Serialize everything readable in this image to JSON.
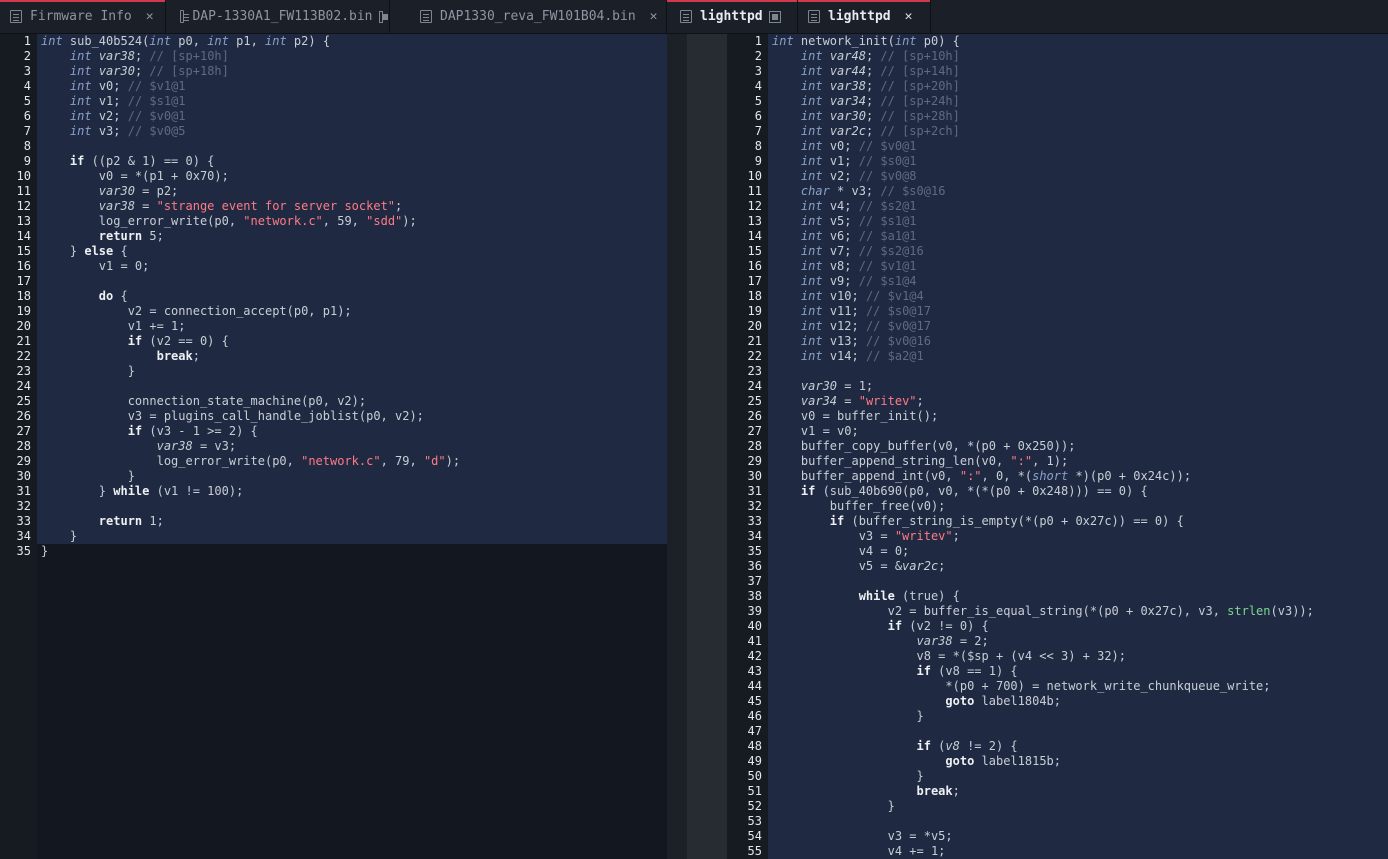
{
  "tabs": [
    {
      "label": "Firmware Info",
      "active": false,
      "close": "✕"
    },
    {
      "label": "DAP-1330A1_FW113B02.bin",
      "active": false
    },
    {
      "label": "DAP1330_reva_FW101B04.bin",
      "active": false,
      "close": "✕"
    },
    {
      "label": "lighttpd",
      "active": true
    },
    {
      "label": "lighttpd",
      "active": true,
      "close": "✕"
    }
  ],
  "colors": {
    "accent": "#d2394a",
    "code_bg": "#1f2a42",
    "editor_bg": "#131720"
  },
  "left_code": [
    [
      [
        "t",
        "int"
      ],
      [
        "p",
        " sub_40b524("
      ],
      [
        "t",
        "int"
      ],
      [
        "p",
        " p0, "
      ],
      [
        "t",
        "int"
      ],
      [
        "p",
        " p1, "
      ],
      [
        "t",
        "int"
      ],
      [
        "p",
        " p2) {"
      ]
    ],
    [
      [
        "p",
        "    "
      ],
      [
        "t",
        "int"
      ],
      [
        "p",
        " "
      ],
      [
        "v",
        "var38"
      ],
      [
        "p",
        "; "
      ],
      [
        "c",
        "// [sp+10h]"
      ]
    ],
    [
      [
        "p",
        "    "
      ],
      [
        "t",
        "int"
      ],
      [
        "p",
        " "
      ],
      [
        "v",
        "var30"
      ],
      [
        "p",
        "; "
      ],
      [
        "c",
        "// [sp+18h]"
      ]
    ],
    [
      [
        "p",
        "    "
      ],
      [
        "t",
        "int"
      ],
      [
        "p",
        " v0; "
      ],
      [
        "c",
        "// $v1@1"
      ]
    ],
    [
      [
        "p",
        "    "
      ],
      [
        "t",
        "int"
      ],
      [
        "p",
        " v1; "
      ],
      [
        "c",
        "// $s1@1"
      ]
    ],
    [
      [
        "p",
        "    "
      ],
      [
        "t",
        "int"
      ],
      [
        "p",
        " v2; "
      ],
      [
        "c",
        "// $v0@1"
      ]
    ],
    [
      [
        "p",
        "    "
      ],
      [
        "t",
        "int"
      ],
      [
        "p",
        " v3; "
      ],
      [
        "c",
        "// $v0@5"
      ]
    ],
    [],
    [
      [
        "p",
        "    "
      ],
      [
        "k",
        "if"
      ],
      [
        "p",
        " ((p2 & 1) == 0) {"
      ]
    ],
    [
      [
        "p",
        "        v0 = *(p1 + 0x70);"
      ]
    ],
    [
      [
        "p",
        "        "
      ],
      [
        "v",
        "var30"
      ],
      [
        "p",
        " = p2;"
      ]
    ],
    [
      [
        "p",
        "        "
      ],
      [
        "v",
        "var38"
      ],
      [
        "p",
        " = "
      ],
      [
        "s",
        "\"strange event for server socket\""
      ],
      [
        "p",
        ";"
      ]
    ],
    [
      [
        "p",
        "        log_error_write(p0, "
      ],
      [
        "s",
        "\"network.c\""
      ],
      [
        "p",
        ", 59, "
      ],
      [
        "s",
        "\"sdd\""
      ],
      [
        "p",
        ");"
      ]
    ],
    [
      [
        "p",
        "        "
      ],
      [
        "k",
        "return"
      ],
      [
        "p",
        " 5;"
      ]
    ],
    [
      [
        "p",
        "    } "
      ],
      [
        "k",
        "else"
      ],
      [
        "p",
        " {"
      ]
    ],
    [
      [
        "p",
        "        v1 = 0;"
      ]
    ],
    [],
    [
      [
        "p",
        "        "
      ],
      [
        "k",
        "do"
      ],
      [
        "p",
        " {"
      ]
    ],
    [
      [
        "p",
        "            v2 = connection_accept(p0, p1);"
      ]
    ],
    [
      [
        "p",
        "            v1 += 1;"
      ]
    ],
    [
      [
        "p",
        "            "
      ],
      [
        "k",
        "if"
      ],
      [
        "p",
        " (v2 == 0) {"
      ]
    ],
    [
      [
        "p",
        "                "
      ],
      [
        "k",
        "break"
      ],
      [
        "p",
        ";"
      ]
    ],
    [
      [
        "p",
        "            }"
      ]
    ],
    [],
    [
      [
        "p",
        "            connection_state_machine(p0, v2);"
      ]
    ],
    [
      [
        "p",
        "            v3 = plugins_call_handle_joblist(p0, v2);"
      ]
    ],
    [
      [
        "p",
        "            "
      ],
      [
        "k",
        "if"
      ],
      [
        "p",
        " (v3 - 1 >= 2) {"
      ]
    ],
    [
      [
        "p",
        "                "
      ],
      [
        "v",
        "var38"
      ],
      [
        "p",
        " = v3;"
      ]
    ],
    [
      [
        "p",
        "                log_error_write(p0, "
      ],
      [
        "s",
        "\"network.c\""
      ],
      [
        "p",
        ", 79, "
      ],
      [
        "s",
        "\"d\""
      ],
      [
        "p",
        ");"
      ]
    ],
    [
      [
        "p",
        "            }"
      ]
    ],
    [
      [
        "p",
        "        } "
      ],
      [
        "k",
        "while"
      ],
      [
        "p",
        " (v1 != 100);"
      ]
    ],
    [],
    [
      [
        "p",
        "        "
      ],
      [
        "k",
        "return"
      ],
      [
        "p",
        " 1;"
      ]
    ],
    [
      [
        "p",
        "    }"
      ]
    ],
    [
      [
        "p",
        "}"
      ]
    ]
  ],
  "right_code": [
    [
      [
        "t",
        "int"
      ],
      [
        "p",
        " network_init("
      ],
      [
        "t",
        "int"
      ],
      [
        "p",
        " p0) {"
      ]
    ],
    [
      [
        "p",
        "    "
      ],
      [
        "t",
        "int"
      ],
      [
        "p",
        " "
      ],
      [
        "v",
        "var48"
      ],
      [
        "p",
        "; "
      ],
      [
        "c",
        "// [sp+10h]"
      ]
    ],
    [
      [
        "p",
        "    "
      ],
      [
        "t",
        "int"
      ],
      [
        "p",
        " "
      ],
      [
        "v",
        "var44"
      ],
      [
        "p",
        "; "
      ],
      [
        "c",
        "// [sp+14h]"
      ]
    ],
    [
      [
        "p",
        "    "
      ],
      [
        "t",
        "int"
      ],
      [
        "p",
        " "
      ],
      [
        "v",
        "var38"
      ],
      [
        "p",
        "; "
      ],
      [
        "c",
        "// [sp+20h]"
      ]
    ],
    [
      [
        "p",
        "    "
      ],
      [
        "t",
        "int"
      ],
      [
        "p",
        " "
      ],
      [
        "v",
        "var34"
      ],
      [
        "p",
        "; "
      ],
      [
        "c",
        "// [sp+24h]"
      ]
    ],
    [
      [
        "p",
        "    "
      ],
      [
        "t",
        "int"
      ],
      [
        "p",
        " "
      ],
      [
        "v",
        "var30"
      ],
      [
        "p",
        "; "
      ],
      [
        "c",
        "// [sp+28h]"
      ]
    ],
    [
      [
        "p",
        "    "
      ],
      [
        "t",
        "int"
      ],
      [
        "p",
        " "
      ],
      [
        "v",
        "var2c"
      ],
      [
        "p",
        "; "
      ],
      [
        "c",
        "// [sp+2ch]"
      ]
    ],
    [
      [
        "p",
        "    "
      ],
      [
        "t",
        "int"
      ],
      [
        "p",
        " v0; "
      ],
      [
        "c",
        "// $v0@1"
      ]
    ],
    [
      [
        "p",
        "    "
      ],
      [
        "t",
        "int"
      ],
      [
        "p",
        " v1; "
      ],
      [
        "c",
        "// $s0@1"
      ]
    ],
    [
      [
        "p",
        "    "
      ],
      [
        "t",
        "int"
      ],
      [
        "p",
        " v2; "
      ],
      [
        "c",
        "// $v0@8"
      ]
    ],
    [
      [
        "p",
        "    "
      ],
      [
        "t",
        "char"
      ],
      [
        "p",
        " * v3; "
      ],
      [
        "c",
        "// $s0@16"
      ]
    ],
    [
      [
        "p",
        "    "
      ],
      [
        "t",
        "int"
      ],
      [
        "p",
        " v4; "
      ],
      [
        "c",
        "// $s2@1"
      ]
    ],
    [
      [
        "p",
        "    "
      ],
      [
        "t",
        "int"
      ],
      [
        "p",
        " v5; "
      ],
      [
        "c",
        "// $s1@1"
      ]
    ],
    [
      [
        "p",
        "    "
      ],
      [
        "t",
        "int"
      ],
      [
        "p",
        " v6; "
      ],
      [
        "c",
        "// $a1@1"
      ]
    ],
    [
      [
        "p",
        "    "
      ],
      [
        "t",
        "int"
      ],
      [
        "p",
        " v7; "
      ],
      [
        "c",
        "// $s2@16"
      ]
    ],
    [
      [
        "p",
        "    "
      ],
      [
        "t",
        "int"
      ],
      [
        "p",
        " v8; "
      ],
      [
        "c",
        "// $v1@1"
      ]
    ],
    [
      [
        "p",
        "    "
      ],
      [
        "t",
        "int"
      ],
      [
        "p",
        " v9; "
      ],
      [
        "c",
        "// $s1@4"
      ]
    ],
    [
      [
        "p",
        "    "
      ],
      [
        "t",
        "int"
      ],
      [
        "p",
        " v10; "
      ],
      [
        "c",
        "// $v1@4"
      ]
    ],
    [
      [
        "p",
        "    "
      ],
      [
        "t",
        "int"
      ],
      [
        "p",
        " v11; "
      ],
      [
        "c",
        "// $s0@17"
      ]
    ],
    [
      [
        "p",
        "    "
      ],
      [
        "t",
        "int"
      ],
      [
        "p",
        " v12; "
      ],
      [
        "c",
        "// $v0@17"
      ]
    ],
    [
      [
        "p",
        "    "
      ],
      [
        "t",
        "int"
      ],
      [
        "p",
        " v13; "
      ],
      [
        "c",
        "// $v0@16"
      ]
    ],
    [
      [
        "p",
        "    "
      ],
      [
        "t",
        "int"
      ],
      [
        "p",
        " v14; "
      ],
      [
        "c",
        "// $a2@1"
      ]
    ],
    [],
    [
      [
        "p",
        "    "
      ],
      [
        "v",
        "var30"
      ],
      [
        "p",
        " = 1;"
      ]
    ],
    [
      [
        "p",
        "    "
      ],
      [
        "v",
        "var34"
      ],
      [
        "p",
        " = "
      ],
      [
        "s",
        "\"writev\""
      ],
      [
        "p",
        ";"
      ]
    ],
    [
      [
        "p",
        "    v0 = buffer_init();"
      ]
    ],
    [
      [
        "p",
        "    v1 = v0;"
      ]
    ],
    [
      [
        "p",
        "    buffer_copy_buffer(v0, *(p0 + 0x250));"
      ]
    ],
    [
      [
        "p",
        "    buffer_append_string_len(v0, "
      ],
      [
        "s",
        "\":\""
      ],
      [
        "p",
        ", 1);"
      ]
    ],
    [
      [
        "p",
        "    buffer_append_int(v0, "
      ],
      [
        "s",
        "\":\""
      ],
      [
        "p",
        ", 0, *("
      ],
      [
        "t",
        "short"
      ],
      [
        "p",
        " *)(p0 + 0x24c));"
      ]
    ],
    [
      [
        "p",
        "    "
      ],
      [
        "k",
        "if"
      ],
      [
        "p",
        " (sub_40b690(p0, v0, *(*(p0 + 0x248))) == 0) {"
      ]
    ],
    [
      [
        "p",
        "        buffer_free(v0);"
      ]
    ],
    [
      [
        "p",
        "        "
      ],
      [
        "k",
        "if"
      ],
      [
        "p",
        " (buffer_string_is_empty(*(p0 + 0x27c)) == 0) {"
      ]
    ],
    [
      [
        "p",
        "            v3 = "
      ],
      [
        "s",
        "\"writev\""
      ],
      [
        "p",
        ";"
      ]
    ],
    [
      [
        "p",
        "            v4 = 0;"
      ]
    ],
    [
      [
        "p",
        "            v5 = &"
      ],
      [
        "v",
        "var2c"
      ],
      [
        "p",
        ";"
      ]
    ],
    [],
    [
      [
        "p",
        "            "
      ],
      [
        "k",
        "while"
      ],
      [
        "p",
        " (true) {"
      ]
    ],
    [
      [
        "p",
        "                v2 = buffer_is_equal_string(*(p0 + 0x27c), v3, "
      ],
      [
        "f",
        "strlen"
      ],
      [
        "p",
        "(v3));"
      ]
    ],
    [
      [
        "p",
        "                "
      ],
      [
        "k",
        "if"
      ],
      [
        "p",
        " (v2 != 0) {"
      ]
    ],
    [
      [
        "p",
        "                    "
      ],
      [
        "v",
        "var38"
      ],
      [
        "p",
        " = 2;"
      ]
    ],
    [
      [
        "p",
        "                    v8 = *($sp + (v4 << 3) + 32);"
      ]
    ],
    [
      [
        "p",
        "                    "
      ],
      [
        "k",
        "if"
      ],
      [
        "p",
        " (v8 == 1) {"
      ]
    ],
    [
      [
        "p",
        "                        *(p0 + 700) = network_write_chunkqueue_write;"
      ]
    ],
    [
      [
        "p",
        "                        "
      ],
      [
        "k",
        "goto"
      ],
      [
        "p",
        " label1804b;"
      ]
    ],
    [
      [
        "p",
        "                    }"
      ]
    ],
    [],
    [
      [
        "p",
        "                    "
      ],
      [
        "k",
        "if"
      ],
      [
        "p",
        " ("
      ],
      [
        "v",
        "v8"
      ],
      [
        "p",
        " != 2) {"
      ]
    ],
    [
      [
        "p",
        "                        "
      ],
      [
        "k",
        "goto"
      ],
      [
        "p",
        " label1815b;"
      ]
    ],
    [
      [
        "p",
        "                    }"
      ]
    ],
    [
      [
        "p",
        "                    "
      ],
      [
        "k",
        "break"
      ],
      [
        "p",
        ";"
      ]
    ],
    [
      [
        "p",
        "                }"
      ]
    ],
    [],
    [
      [
        "p",
        "                v3 = *v5;"
      ]
    ],
    [
      [
        "p",
        "                v4 += 1;"
      ]
    ]
  ]
}
